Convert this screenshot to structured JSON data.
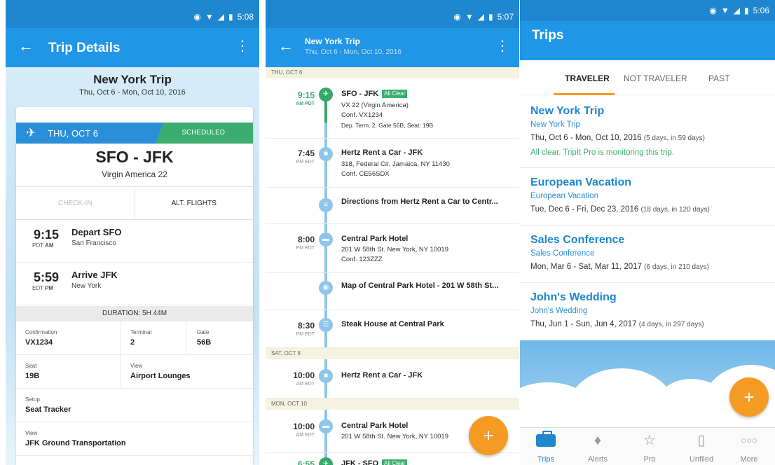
{
  "colors": {
    "primary": "#2196e6",
    "status_bar": "#1e87d0",
    "accent": "#f59a23",
    "success": "#3bae6f",
    "rail": "#8ec6ea"
  },
  "status_bar": {
    "time_s1": "5:08",
    "time_s2": "5:07",
    "time_s3": "5:06"
  },
  "trip_details": {
    "app_title": "Trip Details",
    "trip_name": "New York Trip",
    "trip_dates": "Thu, Oct 6 - Mon, Oct 10, 2016",
    "flight": {
      "day": "THU, OCT 6",
      "status": "SCHEDULED",
      "route": "SFO - JFK",
      "airline": "Virgin America 22",
      "checkin_label": "CHECK-IN",
      "alt_flights_label": "ALT. FLIGHTS",
      "depart": {
        "time": "9:15",
        "tz": "PDT",
        "ampm": "AM",
        "label": "Depart SFO",
        "city": "San Francisco"
      },
      "arrive": {
        "time": "5:59",
        "tz": "EDT",
        "ampm": "PM",
        "label": "Arrive JFK",
        "city": "New York"
      },
      "duration": "DURATION: 5H 44M",
      "confirmation_label": "Confirmation",
      "confirmation": "VX1234",
      "terminal_label": "Terminal",
      "terminal": "2",
      "gate_label": "Gate",
      "gate": "56B",
      "seat_label": "Seat",
      "seat": "19B",
      "view_label": "View",
      "view_lounges": "Airport Lounges",
      "setup_label": "Setup",
      "seat_tracker": "Seat Tracker",
      "view2_label": "View",
      "ground_transport": "JFK Ground Transportation"
    }
  },
  "itinerary": {
    "title": "New York Trip",
    "subtitle": "Thu, Oct 6 - Mon, Oct 10, 2016",
    "day_thu": "THU, OCT 6",
    "day_sat": "SAT, OCT 8",
    "day_mon": "MON, OCT 10",
    "items": [
      {
        "time": "9:15",
        "tz": "AM PDT",
        "title": "SFO - JFK",
        "badge": "All Clear",
        "l1": "VX 22 (Virgin America)",
        "l2": "Conf. VX1234",
        "l3": "Dep. Term. 2, Gate 56B, Seat: 19B"
      },
      {
        "time": "7:45",
        "tz": "PM EDT",
        "title": "Hertz Rent a Car - JFK",
        "l1": "318, Federal Cir, Jamaica, NY 11430",
        "l2": "Conf. CE56SDX"
      },
      {
        "title": "Directions from Hertz Rent a Car to Centr..."
      },
      {
        "time": "8:00",
        "tz": "PM EDT",
        "title": "Central Park Hotel",
        "l1": "201 W 58th St. New York, NY 10019",
        "l2": "Conf. 123ZZZ"
      },
      {
        "title": "Map of Central Park Hotel - 201 W 58th St..."
      },
      {
        "time": "8:30",
        "tz": "PM EDT",
        "title": "Steak House at Central Park"
      },
      {
        "time": "10:00",
        "tz": "AM EDT",
        "title": "Hertz Rent a Car - JFK"
      },
      {
        "time": "10:00",
        "tz": "AM EDT",
        "title": "Central Park Hotel",
        "l1": "201 W 58th St. New York, NY 10019"
      },
      {
        "time": "6:55",
        "title": "JFK - SFO",
        "badge": "All Clear"
      }
    ],
    "fab": "+"
  },
  "trips": {
    "title": "Trips",
    "tabs": [
      "TRAVELER",
      "NOT TRAVELER",
      "PAST"
    ],
    "list": [
      {
        "name": "New York Trip",
        "sub": "New York Trip",
        "dates": "Thu, Oct 6 - Mon, Oct 10, 2016",
        "meta": "(5 days, in 59 days)",
        "alert": "All clear. TripIt Pro is monitoring this trip."
      },
      {
        "name": "European Vacation",
        "sub": "European Vacation",
        "dates": "Tue, Dec 6 - Fri, Dec 23, 2016",
        "meta": "(18 days, in 120 days)"
      },
      {
        "name": "Sales Conference",
        "sub": "Sales Conference",
        "dates": "Mon, Mar 6 - Sat, Mar 11, 2017",
        "meta": "(6 days, in 210 days)"
      },
      {
        "name": "John's Wedding",
        "sub": "John's Wedding",
        "dates": "Thu, Jun 1 - Sun, Jun 4, 2017",
        "meta": "(4 days, in 297 days)"
      }
    ],
    "fab": "+",
    "nav": [
      "Trips",
      "Alerts",
      "Pro",
      "Unfiled",
      "More"
    ]
  }
}
